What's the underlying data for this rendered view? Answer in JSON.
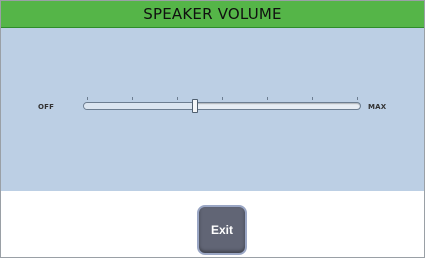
{
  "header": {
    "title": "SPEAKER VOLUME"
  },
  "volume_slider": {
    "min_label": "OFF",
    "max_label": "MAX",
    "value_fraction": 0.4,
    "tick_count": 7
  },
  "footer": {
    "exit_label": "Exit"
  },
  "colors": {
    "title_bar": "#55b548",
    "panel_background": "#bccfe4",
    "exit_button": "#616575"
  }
}
